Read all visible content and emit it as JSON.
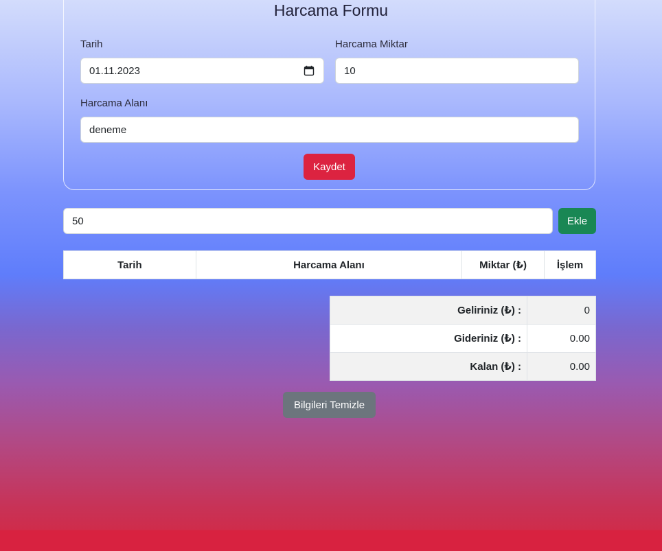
{
  "form": {
    "title": "Harcama Formu",
    "date_label": "Tarih",
    "date_value": "01.11.2023",
    "amount_label": "Harcama Miktar",
    "amount_value": "10",
    "area_label": "Harcama Alanı",
    "area_value": "deneme",
    "save_label": "Kaydet"
  },
  "income": {
    "input_value": "50",
    "add_label": "Ekle"
  },
  "expense_table": {
    "headers": [
      "Tarih",
      "Harcama Alanı",
      "Miktar (₺)",
      "İşlem"
    ],
    "rows": []
  },
  "summary": {
    "income_label": "Geliriniz (₺) :",
    "income_value": "0",
    "expense_label": "Gideriniz (₺) :",
    "expense_value": "0.00",
    "remaining_label": "Kalan (₺) :",
    "remaining_value": "0.00"
  },
  "clear_label": "Bilgileri Temizle",
  "colors": {
    "save_button": "#dc2340",
    "add_button": "#198754",
    "clear_button": "#6c757d"
  },
  "icons": {
    "date_picker": "calendar-icon"
  }
}
